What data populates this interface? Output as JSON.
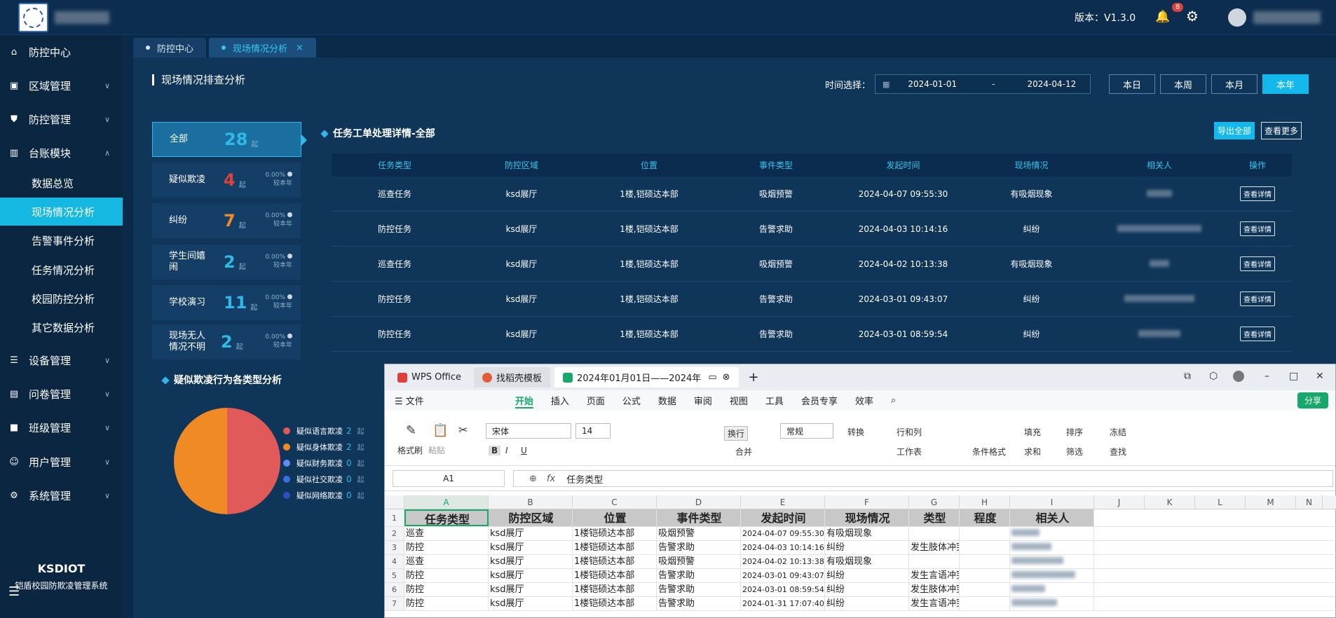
{
  "header": {
    "version_label": "版本：V1.3.0",
    "badge_count": "8"
  },
  "sidebar": {
    "items": [
      {
        "label": "防控中心",
        "icon": "home-icon"
      },
      {
        "label": "区域管理",
        "icon": "region-icon"
      },
      {
        "label": "防控管理",
        "icon": "shield-icon"
      },
      {
        "label": "台账模块",
        "icon": "bar-chart-icon"
      },
      {
        "label": "设备管理",
        "icon": "device-icon"
      },
      {
        "label": "问卷管理",
        "icon": "survey-icon"
      },
      {
        "label": "班级管理",
        "icon": "class-icon"
      },
      {
        "label": "用户管理",
        "icon": "user-icon"
      },
      {
        "label": "系统管理",
        "icon": "gear-icon"
      }
    ],
    "sub_items": [
      "数据总览",
      "现场情况分析",
      "告警事件分析",
      "任务情况分析",
      "校园防控分析",
      "其它数据分析"
    ],
    "brand": "KSDIOT",
    "brand_sub": "铠盾校园防欺凌管理系统"
  },
  "tabs": [
    {
      "label": "防控中心"
    },
    {
      "label": "现场情况分析"
    }
  ],
  "page": {
    "title": "现场情况排查分析",
    "time_label": "时间选择：",
    "date_start": "2024-01-01",
    "date_sep": "-",
    "date_end": "2024-04-12",
    "periods": [
      "本日",
      "本周",
      "本月",
      "本年"
    ]
  },
  "stats": [
    {
      "label": "全部",
      "count": "28",
      "unit": "起",
      "color": "#2fb8e8"
    },
    {
      "label": "疑似欺凌",
      "count": "4",
      "unit": "起",
      "pct": "0.00%",
      "sub": "较本年",
      "color": "#e0403c"
    },
    {
      "label": "纠纷",
      "count": "7",
      "unit": "起",
      "pct": "0.00%",
      "sub": "较本年",
      "color": "#f08a24"
    },
    {
      "label": "学生间嬉闹",
      "count": "2",
      "unit": "起",
      "pct": "0.00%",
      "sub": "较本年",
      "color": "#2fb8e8"
    },
    {
      "label": "学校演习",
      "count": "11",
      "unit": "起",
      "pct": "0.00%",
      "sub": "较本年",
      "color": "#2fb8e8"
    },
    {
      "label": "现场无人情况不明",
      "count": "2",
      "unit": "起",
      "pct": "0.00%",
      "sub": "较本年",
      "color": "#2fb8e8"
    }
  ],
  "detail": {
    "title": "任务工单处理详情-全部",
    "export_label": "导出全部",
    "more_label": "查看更多",
    "columns": [
      "任务类型",
      "防控区域",
      "位置",
      "事件类型",
      "发起时间",
      "现场情况",
      "相关人",
      "操作"
    ],
    "rows": [
      [
        "巡查任务",
        "ksd展厅",
        "1楼,铠硕达本部",
        "吸烟预警",
        "2024-04-07 09:55:30",
        "有吸烟现象"
      ],
      [
        "防控任务",
        "ksd展厅",
        "1楼,铠硕达本部",
        "告警求助",
        "2024-04-03 10:14:16",
        "纠纷"
      ],
      [
        "巡查任务",
        "ksd展厅",
        "1楼,铠硕达本部",
        "吸烟预警",
        "2024-04-02 10:13:38",
        "有吸烟现象"
      ],
      [
        "防控任务",
        "ksd展厅",
        "1楼,铠硕达本部",
        "告警求助",
        "2024-03-01 09:43:07",
        "纠纷"
      ],
      [
        "防控任务",
        "ksd展厅",
        "1楼,铠硕达本部",
        "告警求助",
        "2024-03-01 08:59:54",
        "纠纷"
      ]
    ],
    "action_label": "查看详情"
  },
  "pie": {
    "title": "疑似欺凌行为各类型分析"
  },
  "chart_data": {
    "type": "pie",
    "title": "疑似欺凌行为各类型分析",
    "series": [
      {
        "name": "疑似语言欺凌",
        "value": 2,
        "color": "#e05a5a",
        "unit": "起"
      },
      {
        "name": "疑似身体欺凌",
        "value": 2,
        "color": "#f08a24",
        "unit": "起"
      },
      {
        "name": "疑似财务欺凌",
        "value": 0,
        "color": "#5b8ef0",
        "unit": "起"
      },
      {
        "name": "疑似社交欺凌",
        "value": 0,
        "color": "#3a6fe0",
        "unit": "起"
      },
      {
        "name": "疑似网络欺凌",
        "value": 0,
        "color": "#2c4fc4",
        "unit": "起"
      }
    ]
  },
  "wps": {
    "tabs": [
      "WPS Office",
      "找稻壳模板",
      "2024年01月01日——2024年"
    ],
    "menu": [
      "文件",
      "开始",
      "插入",
      "页面",
      "公式",
      "数据",
      "审阅",
      "视图",
      "工具",
      "会员专享",
      "效率"
    ],
    "share_label": "分享",
    "font_name": "宋体",
    "font_size": "14",
    "number_format": "常规",
    "ribbon": {
      "format_painter": "格式刷",
      "paste": "粘贴",
      "wrap": "换行",
      "convert": "转换",
      "row_col": "行和列",
      "merge": "合并",
      "worksheet": "工作表",
      "cond_format": "条件格式",
      "fill": "填充",
      "sort": "排序",
      "freeze": "冻结",
      "sum": "求和",
      "filter": "筛选",
      "find": "查找"
    },
    "name_box": "A1",
    "fx": "fx",
    "formula_value": "任务类型",
    "columns": [
      "A",
      "B",
      "C",
      "D",
      "E",
      "F",
      "G",
      "H",
      "I",
      "J",
      "K",
      "L",
      "M",
      "N"
    ],
    "header_row": [
      "任务类型",
      "防控区域",
      "位置",
      "事件类型",
      "发起时间",
      "现场情况",
      "类型",
      "程度",
      "相关人"
    ],
    "rows": [
      [
        "巡查",
        "ksd展厅",
        "1楼铠硕达本部",
        "吸烟预警",
        "2024-04-07 09:55:30",
        "有吸烟现象",
        ""
      ],
      [
        "防控",
        "ksd展厅",
        "1楼铠硕达本部",
        "告警求助",
        "2024-04-03 10:14:16",
        "纠纷",
        "发生肢体冲突"
      ],
      [
        "巡查",
        "ksd展厅",
        "1楼铠硕达本部",
        "吸烟预警",
        "2024-04-02 10:13:38",
        "有吸烟现象",
        ""
      ],
      [
        "防控",
        "ksd展厅",
        "1楼铠硕达本部",
        "告警求助",
        "2024-03-01 09:43:07",
        "纠纷",
        "发生言语冲突"
      ],
      [
        "防控",
        "ksd展厅",
        "1楼铠硕达本部",
        "告警求助",
        "2024-03-01 08:59:54",
        "纠纷",
        "发生肢体冲突"
      ],
      [
        "防控",
        "ksd展厅",
        "1楼铠硕达本部",
        "告警求助",
        "2024-01-31 17:07:40",
        "纠纷",
        "发生言语冲突"
      ]
    ]
  }
}
